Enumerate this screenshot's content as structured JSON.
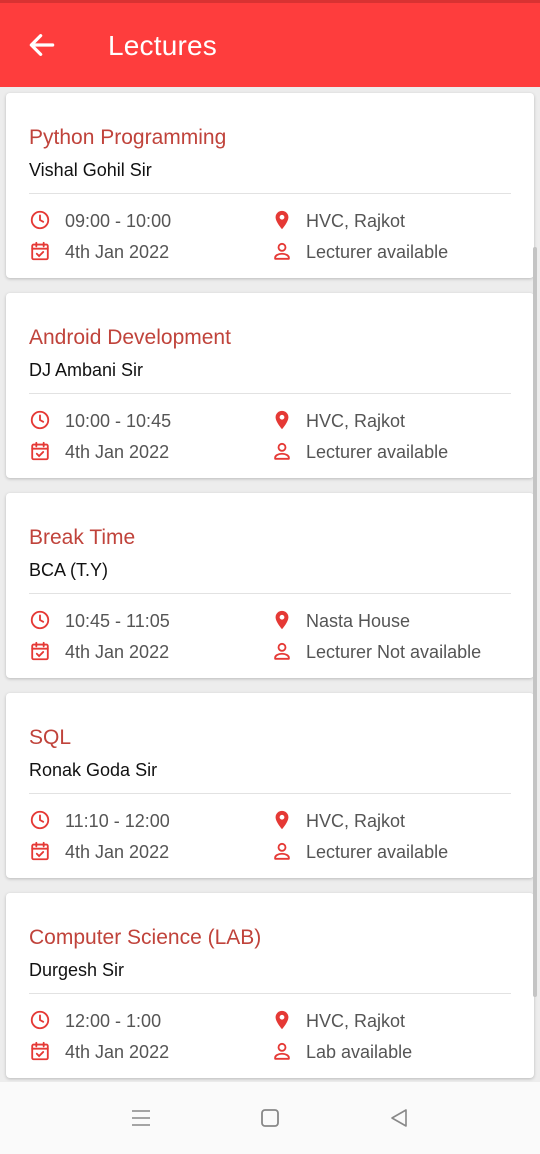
{
  "header": {
    "title": "Lectures",
    "back_icon": "arrow-left-icon"
  },
  "colors": {
    "accent": "#fe3d3d",
    "title_text": "#c0433b",
    "icon": "#e53935"
  },
  "lectures": [
    {
      "subject": "Python Programming",
      "teacher": "Vishal Gohil Sir",
      "time": "09:00 - 10:00",
      "date": "4th Jan 2022",
      "location": "HVC, Rajkot",
      "availability": "Lecturer available"
    },
    {
      "subject": "Android Development",
      "teacher": "DJ Ambani Sir",
      "time": "10:00 - 10:45",
      "date": "4th Jan 2022",
      "location": "HVC, Rajkot",
      "availability": "Lecturer available"
    },
    {
      "subject": "Break Time",
      "teacher": "BCA (T.Y)",
      "time": "10:45 - 11:05",
      "date": "4th Jan 2022",
      "location": "Nasta House",
      "availability": "Lecturer Not available"
    },
    {
      "subject": "SQL",
      "teacher": "Ronak Goda Sir",
      "time": "11:10 - 12:00",
      "date": "4th Jan 2022",
      "location": "HVC, Rajkot",
      "availability": "Lecturer available"
    },
    {
      "subject": "Computer Science (LAB)",
      "teacher": "Durgesh Sir",
      "time": "12:00 - 1:00",
      "date": "4th Jan 2022",
      "location": "HVC, Rajkot",
      "availability": "Lab available"
    }
  ],
  "system_nav": {
    "menu_icon": "menu-icon",
    "home_icon": "square-home-icon",
    "back_icon": "triangle-back-icon"
  }
}
